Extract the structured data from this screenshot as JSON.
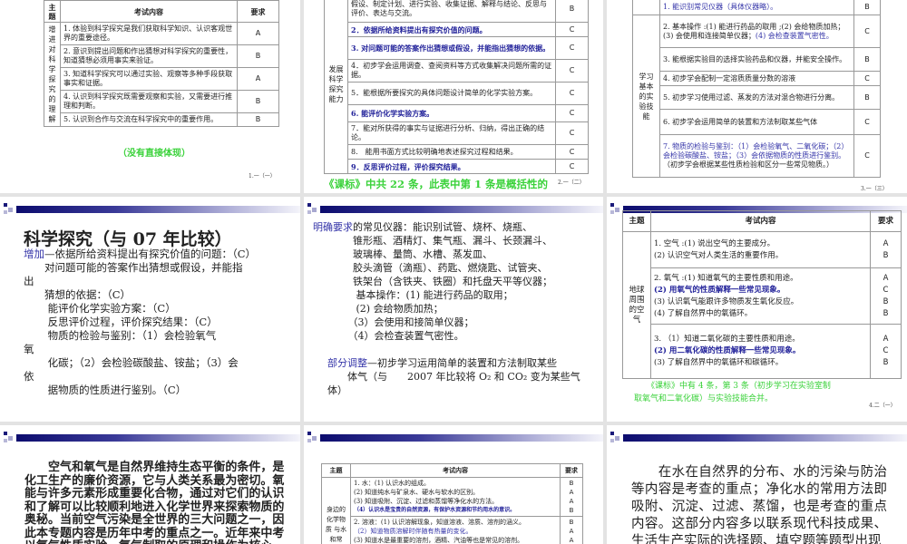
{
  "slide1": {
    "headers": [
      "主题",
      "考试内容",
      "要求"
    ],
    "theme": "增进对科学探究的理解",
    "rows": [
      {
        "c": "1. 体验到科学探究是我们获取科学知识、认识客观世界的重要途径。",
        "r": "A"
      },
      {
        "c": "2. 意识到提出问题和作出猜想对科学探究的重要性，知道猜想必须用事实来验证。",
        "r": "B"
      },
      {
        "c": "3. 知道科学探究可以通过实验、观察等多种手段获取事实和证据。",
        "r": "A"
      },
      {
        "c": "4. 认识到科学探究既需要观察和实验，又需要进行推理和判断。",
        "r": "B"
      },
      {
        "c": "5. 认识到合作与交流在科学探究中的重要作用。",
        "r": "B"
      }
    ],
    "note": "（没有直接体现）",
    "page": "1.一（一）"
  },
  "slide2": {
    "theme": "发展科学探究能力",
    "rows": [
      {
        "c": "假设、制定计划、进行实验、收集证据、解释与结论、反思与评价、表达与交流。",
        "r": "B",
        "s": ""
      },
      {
        "c": "2．依据所给资料提出有探究价值的问题。",
        "r": "C",
        "s": "bblue"
      },
      {
        "c": "3. 对问题可能的答案作出猜想或假设，并能指出猜想的依据。",
        "r": "C",
        "s": "bblue"
      },
      {
        "c": "4．初步学会运用调查、查阅资料等方式收集解决问题所需的证据。",
        "r": "C",
        "s": ""
      },
      {
        "c": "5．能根据所要探究的具体问题设计简单的化学实验方案。",
        "r": "C",
        "s": ""
      },
      {
        "c": "6. 能评价化学实验方案。",
        "r": "C",
        "s": "bblue"
      },
      {
        "c": "7．能对所获得的事实与证据进行分析、归纳，得出正确的结论。",
        "r": "C",
        "s": ""
      },
      {
        "c": "8.　能用书面方式比较明确地表述探究过程和结果。",
        "r": "C",
        "s": ""
      },
      {
        "c": "9．反思评价过程，评价探究结果。",
        "r": "C",
        "s": "bblue"
      }
    ],
    "note": "《课标》中共 22 条，此表中第 1 条是概括性的",
    "page": "2.一（二）"
  },
  "slide3": {
    "theme": "学习基本的实验技能",
    "rows": [
      {
        "c": "1. 能识别常见仪器（具体仪器略）。",
        "r": "B",
        "s": "blue"
      },
      {
        "c": "2. 基本操作 :(1) 能进行药品的取用 ;(2) 会给物质加热；(3) 会使用和连接简单仪器；",
        "c2": "(4) 会检查装置气密性。",
        "r": "C",
        "s": ""
      },
      {
        "c": "3. 能根据实验目的选择实验药品和仪器，并能安全操作。",
        "r": "B",
        "s": ""
      },
      {
        "c": "4. 初步学会配制一定溶质质量分数的溶液",
        "r": "C",
        "s": ""
      },
      {
        "c": "5. 初步学习使用过滤、蒸发的方法对混合物进行分离。",
        "r": "B",
        "s": ""
      },
      {
        "c": "6. 初步学会运用简单的装置和方法制取某些气体",
        "r": "C",
        "s": ""
      },
      {
        "c": "7. 物质的检验与鉴别：（1）会检验氧气、二氧化碳；（2）会检验碳酸盐、铵盐；（3）会依据物质的性质进行鉴别。",
        "c2": "（初步学会根据某些性质检验和区分一些常见物质。）",
        "r": "C",
        "s": "blue"
      }
    ],
    "page": "3.一（三）"
  },
  "slide4": {
    "title": "科学探究（与 07 年比较）",
    "label": "增加",
    "lines": [
      "—依据所给资料提出有探究价值的问题：（C）",
      "　　对问题可能的答案作出猜想或假设，并能指",
      "出",
      "　　猜想的依据：（C）",
      "　　 能评价化学实验方案：（C）",
      "　　 反思评价过程，评价探究结果：（C）",
      "　　 物质的检验与鉴别：（1）会检验氧气",
      "氧",
      "　　 化碳；（2）会检验碳酸盐、铵盐；（3）会",
      "依",
      "　　 据物质的性质进行鉴别。（C）"
    ]
  },
  "slide5": {
    "label1": "明确要求",
    "lines": [
      "的常见仪器：能识别试管、烧杯、烧瓶、",
      "　　　　锥形瓶、酒精灯、集气瓶、漏斗、长颈漏斗、",
      "　　　　玻璃棒、量筒、水槽、蒸发皿、",
      "　　　　胶头滴管（滴瓶）、药匙、燃烧匙、试管夹、",
      "　　　　铁架台（含铁夹、铁圈）和托盘天平等仪器；",
      "　　　　 基本操作：(1) 能进行药品的取用；",
      "　　　　 (2) 会给物质加热；",
      "　　　　（3）会使用和接简单仪器；",
      "　　　　（4）会检查装置气密性。"
    ],
    "label2": "部分调整",
    "lines2": [
      "—初步学习运用简单的装置和方法制取某些",
      "　　体气（与　　2007 年比较将 O₂ 和 CO₂ 变为某些气",
      "体）"
    ]
  },
  "slide6": {
    "headers": [
      "主题",
      "考试内容",
      "要求"
    ],
    "theme": "地球周围的空气",
    "rows": [
      {
        "lines": [
          "1. 空气 :(1) 说出空气的主要成分。",
          "(2) 认识空气对人类生活的重要作用。"
        ],
        "r": [
          "A",
          "B"
        ]
      },
      {
        "lines": [
          "2. 氧气 :(1) 知道氧气的主要性质和用途。",
          "(2) 用氧气的性质解释一些常见现象。",
          "(3) 认识氧气能跟许多物质发生氧化反应。",
          "(4) 了解自然界中的氧循环。"
        ],
        "r": [
          "A",
          "C",
          "B",
          "B"
        ]
      },
      {
        "lines": [
          "3. （1）知道二氧化碳的主要性质和用途。",
          "(2) 用二氧化碳的性质解释一些常见现象。",
          "(3) 了解自然界中的氧循环和碳循环。"
        ],
        "r": [
          "A",
          "C",
          "B"
        ]
      }
    ],
    "note1": "《课标》中有 4 条，第 3 条（初步学习在实验室制",
    "note2": "取氧气和二氧化碳）与实验技能合并。",
    "page": "4.二（一）"
  },
  "slide7": {
    "text": "　　空气和氧气是自然界维持生态平衡的条件，是化工生产的廉价资源，它与人类关系最为密切。氧能与许多元素形成重要化合物，通过对它们的认识和了解可以比较顺利地进入化学世界来探索物质的奥秘。当前空气污染是全世界的三大问题之一，因此本专题内容是历年中考的重点之一。近年来中考以氧气性质实验、氧气制取的原理和操作为核心，考查观察能力、描述能力、实验动手能"
  },
  "slide8": {
    "headers": [
      "主题",
      "考试内容",
      "要求"
    ],
    "theme": "身边的化学物质 与水 和常",
    "rows": [
      {
        "lines": [
          "1. 水：(1) 认识水的组成。",
          "(2) 知道纯水与矿泉水、硬水与软水的区别。",
          "(3) 知道吸附、沉淀、过滤和蒸馏等净化水的方法。",
          "（4）认识水是宝贵的自然资源，有保护水资源和节约用水的意识。"
        ],
        "r": [
          "B",
          "A",
          "A",
          "B"
        ]
      },
      {
        "lines": [
          "2. 溶液：(1) 认识溶解现象，知道溶液、溶质、溶剂的涵义。",
          "（2）知道物质溶解时伴随有热量的变化。",
          "(3) 知道水是最重要的溶剂，酒精、汽油等也是常见的溶剂。"
        ],
        "r": [
          "B",
          "A",
          "A"
        ]
      }
    ]
  },
  "slide9": {
    "text": "　　在水在自然界的分布、水的污染与防治等内容是考查的重点；净化水的常用方法即吸附、沉淀、过滤、蒸馏，也是考查的重点内容。这部分内容多以联系现代科技成果、生活生产实际的选择题、填空题等题型出现"
  }
}
